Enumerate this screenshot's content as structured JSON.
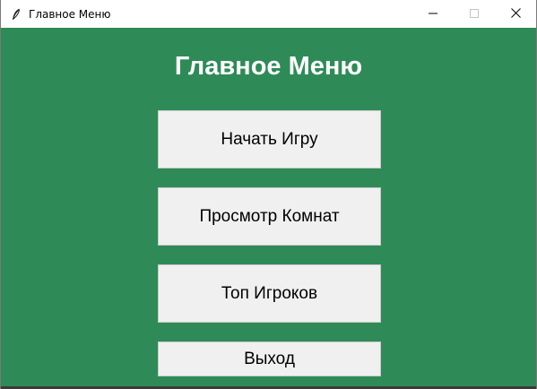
{
  "window": {
    "title": "Главное Меню",
    "icon": "feather-icon",
    "controls": [
      "minimize-icon",
      "maximize-icon",
      "close-icon"
    ]
  },
  "colors": {
    "background": "#2e8b57",
    "button_bg": "#f0f0f0",
    "heading_text": "#ffffff"
  },
  "main": {
    "heading": "Главное Меню",
    "buttons": [
      {
        "label": "Начать Игру"
      },
      {
        "label": "Просмотр Комнат"
      },
      {
        "label": "Топ Игроков"
      },
      {
        "label": "Выход"
      }
    ]
  }
}
